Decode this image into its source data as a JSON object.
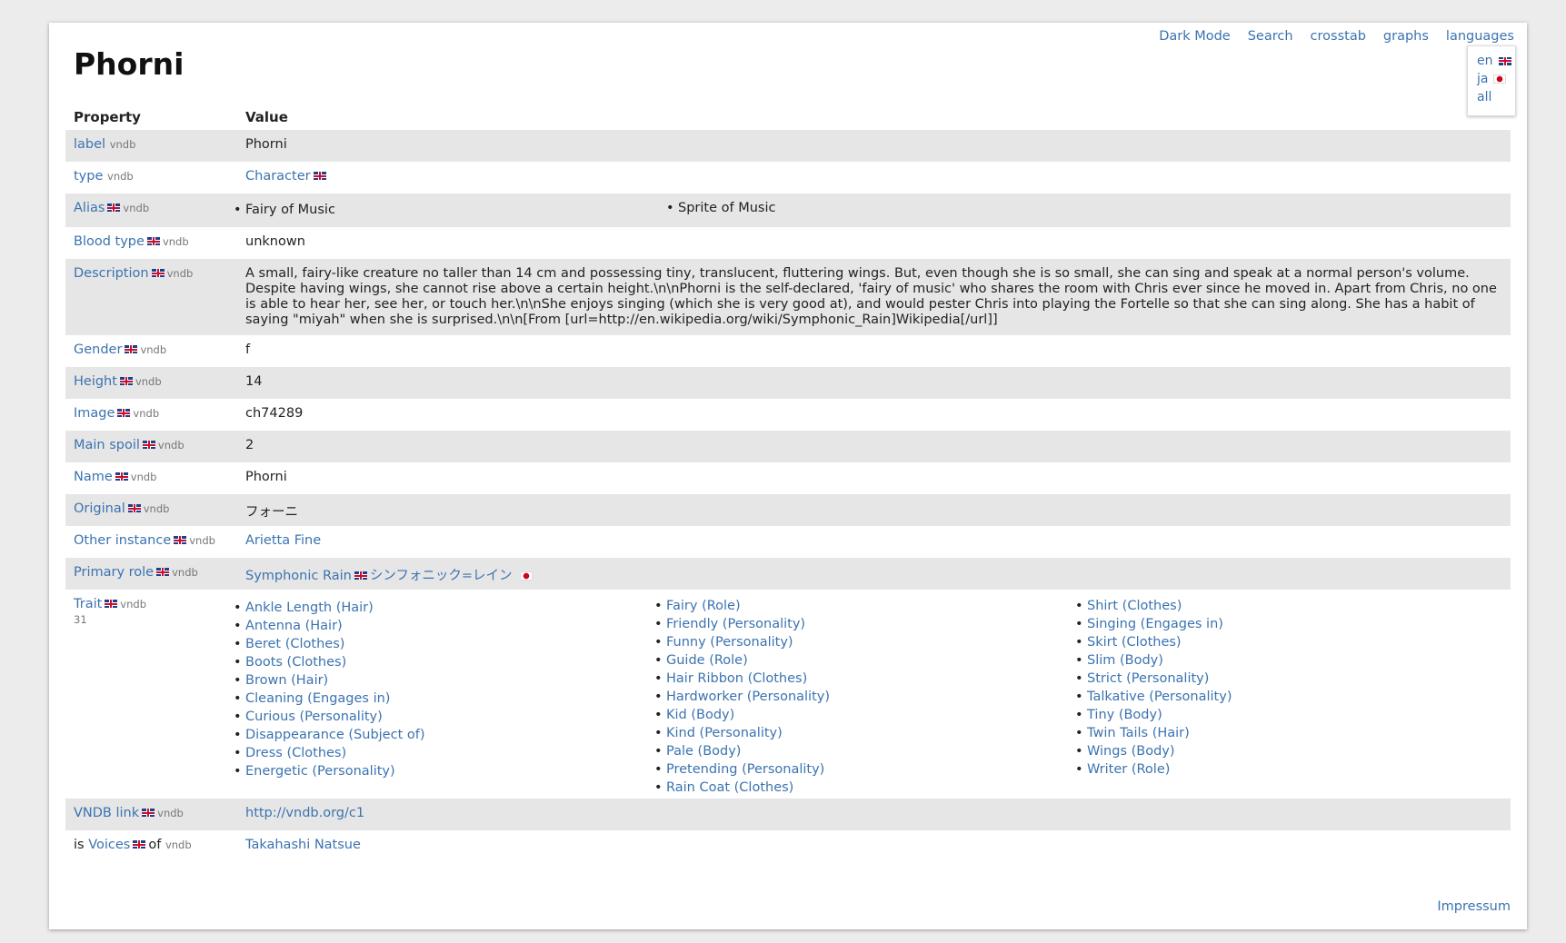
{
  "page_title": "Phorni",
  "nav": {
    "dark_mode": "Dark Mode",
    "search": "Search",
    "crosstab": "crosstab",
    "graphs": "graphs",
    "languages": "languages"
  },
  "language_menu": [
    {
      "label": "en",
      "flag": "uk-flag-icon"
    },
    {
      "label": "ja",
      "flag": "jp-flag-icon"
    },
    {
      "label": "all",
      "flag": ""
    }
  ],
  "table_header": {
    "property": "Property",
    "value": "Value"
  },
  "source_tag": "vndb",
  "rows": {
    "label": {
      "prop": "label",
      "value": "Phorni"
    },
    "type": {
      "prop": "type",
      "value": "Character"
    },
    "alias": {
      "prop": "Alias",
      "values": [
        "Fairy of Music",
        "Sprite of Music"
      ]
    },
    "blood_type": {
      "prop": "Blood type",
      "value": "unknown"
    },
    "description": {
      "prop": "Description",
      "value": "A small, fairy-like creature no taller than 14 cm and possessing tiny, translucent, fluttering wings. But, even though she is so small, she can sing and speak at a normal person's volume. Despite having wings, she cannot rise above a certain height.\\n\\nPhorni is the self-declared, 'fairy of music' who shares the room with Chris ever since he moved in. Apart from Chris, no one is able to hear her, see her, or touch her.\\n\\nShe enjoys singing (which she is very good at), and would pester Chris into playing the Fortelle so that she can sing along. She has a habit of saying \"miyah\" when she is surprised.\\n\\n[From [url=http://en.wikipedia.org/wiki/Symphonic_Rain]Wikipedia[/url]]"
    },
    "gender": {
      "prop": "Gender",
      "value": "f"
    },
    "height": {
      "prop": "Height",
      "value": "14"
    },
    "image": {
      "prop": "Image",
      "value": "ch74289"
    },
    "main_spoil": {
      "prop": "Main spoil",
      "value": "2"
    },
    "name": {
      "prop": "Name",
      "value": "Phorni"
    },
    "original": {
      "prop": "Original",
      "value": "フォーニ"
    },
    "other_instance": {
      "prop": "Other instance",
      "value": "Arietta Fine"
    },
    "primary_role": {
      "prop": "Primary role",
      "value_en": "Symphonic Rain",
      "value_ja": "シンフォニック=レイン"
    },
    "trait": {
      "prop": "Trait",
      "count": "31",
      "columns": [
        [
          "Ankle Length (Hair)",
          "Antenna (Hair)",
          "Beret (Clothes)",
          "Boots (Clothes)",
          "Brown (Hair)",
          "Cleaning (Engages in)",
          "Curious (Personality)",
          "Disappearance (Subject of)",
          "Dress (Clothes)",
          "Energetic (Personality)"
        ],
        [
          "Fairy (Role)",
          "Friendly (Personality)",
          "Funny (Personality)",
          "Guide (Role)",
          "Hair Ribbon (Clothes)",
          "Hardworker (Personality)",
          "Kid (Body)",
          "Kind (Personality)",
          "Pale (Body)",
          "Pretending (Personality)",
          "Rain Coat (Clothes)"
        ],
        [
          "Shirt (Clothes)",
          "Singing (Engages in)",
          "Skirt (Clothes)",
          "Slim (Body)",
          "Strict (Personality)",
          "Talkative (Personality)",
          "Tiny (Body)",
          "Twin Tails (Hair)",
          "Wings (Body)",
          "Writer (Role)"
        ]
      ]
    },
    "vndb_link": {
      "prop": "VNDB link",
      "value": "http://vndb.org/c1"
    },
    "voices": {
      "prefix": "is",
      "prop": "Voices",
      "suffix": "of",
      "value": "Takahashi Natsue"
    }
  },
  "footer": {
    "impressum": "Impressum"
  }
}
